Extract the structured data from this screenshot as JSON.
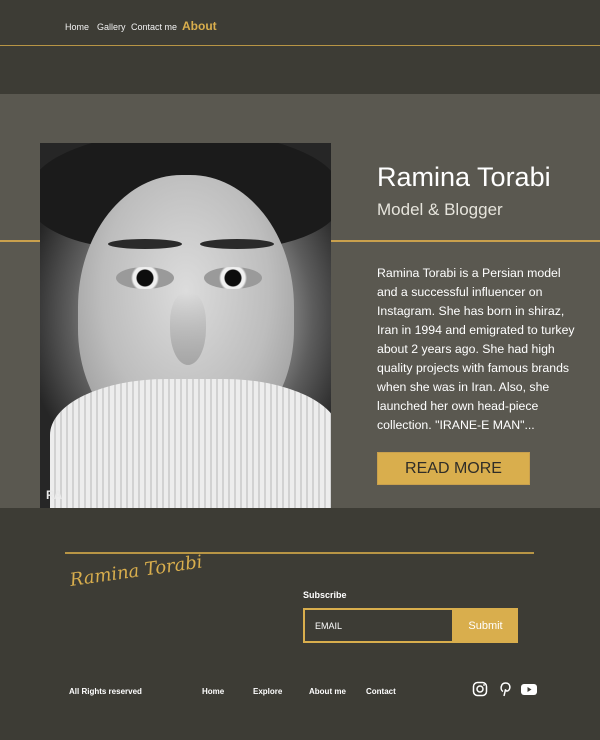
{
  "nav": {
    "items": [
      {
        "label": "Home"
      },
      {
        "label": "Gallery"
      },
      {
        "label": "Contact me"
      },
      {
        "label": "About"
      }
    ],
    "active": "About"
  },
  "hero": {
    "photo_mark": "RA",
    "name": "Ramina Torabi",
    "role": "Model & Blogger",
    "bio": "Ramina Torabi is a Persian model and a successful influencer on Instagram. She has born in shiraz, Iran in 1994 and emigrated to turkey about 2 years ago. She had high quality projects with famous brands when she was in Iran. Also, she launched her own head-piece collection. \"IRANE-E MAN\"...",
    "read_more": "READ MORE"
  },
  "footer": {
    "signature": "Ramina Torabi",
    "subscribe_label": "Subscribe",
    "email_placeholder": "EMAIL",
    "submit": "Submit",
    "rights": "All Rights reserved",
    "links": [
      {
        "label": "Home"
      },
      {
        "label": "Explore"
      },
      {
        "label": "About me"
      },
      {
        "label": "Contact"
      }
    ],
    "social_icons": [
      "instagram-icon",
      "pinterest-icon",
      "youtube-icon"
    ]
  },
  "colors": {
    "background": "#3d3c35",
    "hero_background": "#5a5850",
    "accent": "#d9ae4d"
  }
}
